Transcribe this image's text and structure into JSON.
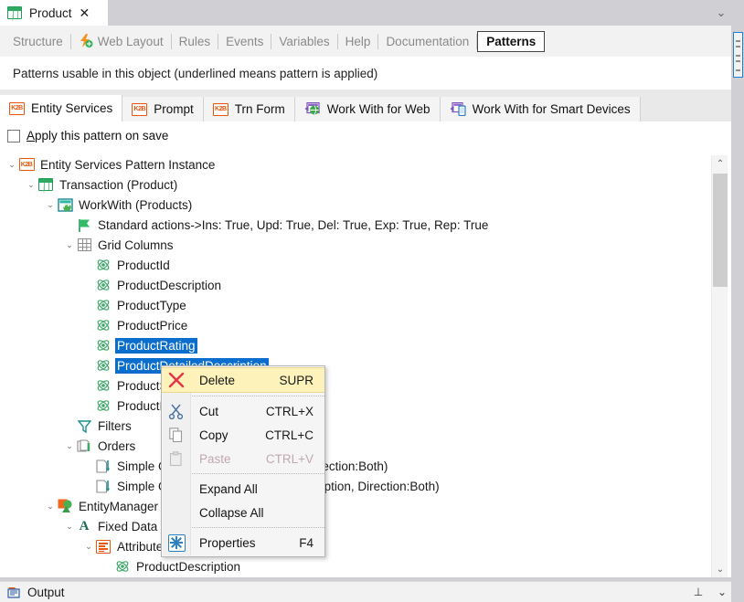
{
  "window": {
    "doc_tab": {
      "label": "Product",
      "close": "✕",
      "icon": "transaction-icon"
    },
    "tabstrip_chevron": "⌄"
  },
  "object_tabs": [
    {
      "label": "Structure",
      "icon": null,
      "active": false
    },
    {
      "label": "Web Layout",
      "icon": "web-layout-icon",
      "active": false
    },
    {
      "label": "Rules",
      "icon": null,
      "active": false
    },
    {
      "label": "Events",
      "icon": null,
      "active": false
    },
    {
      "label": "Variables",
      "icon": null,
      "active": false
    },
    {
      "label": "Help",
      "icon": null,
      "active": false
    },
    {
      "label": "Documentation",
      "icon": null,
      "active": false
    },
    {
      "label": "Patterns",
      "icon": null,
      "active": true
    }
  ],
  "patterns_header": "Patterns usable in this object (underlined means pattern is applied)",
  "pattern_tabs": [
    {
      "label": "Entity Services",
      "icon": "k2b-icon",
      "active": true
    },
    {
      "label": "Prompt",
      "icon": "k2b-icon",
      "active": false
    },
    {
      "label": "Trn Form",
      "icon": "k2b-icon",
      "active": false
    },
    {
      "label": "Work With for Web",
      "icon": "work-with-web-icon",
      "active": false
    },
    {
      "label": "Work With for Smart Devices",
      "icon": "work-with-smart-devices-icon",
      "active": false
    }
  ],
  "apply_checkbox": {
    "label_prefix": "A",
    "label_rest": "pply this pattern on save",
    "checked": false
  },
  "tree": [
    {
      "indent": 0,
      "twisty": "expanded",
      "icon": "k2b-icon",
      "label": "Entity Services Pattern Instance",
      "selected": false
    },
    {
      "indent": 1,
      "twisty": "expanded",
      "icon": "transaction-icon",
      "label": "Transaction (Product)",
      "selected": false
    },
    {
      "indent": 2,
      "twisty": "expanded",
      "icon": "workwith-icon",
      "label": "WorkWith (Products)",
      "selected": false
    },
    {
      "indent": 3,
      "twisty": "none",
      "icon": "flag-icon",
      "label": "Standard actions->Ins: True, Upd: True, Del: True, Exp: True, Rep: True",
      "selected": false
    },
    {
      "indent": 3,
      "twisty": "expanded",
      "icon": "grid-icon",
      "label": "Grid Columns",
      "selected": false
    },
    {
      "indent": 4,
      "twisty": "none",
      "icon": "attribute-icon",
      "label": "ProductId",
      "selected": false
    },
    {
      "indent": 4,
      "twisty": "none",
      "icon": "attribute-icon",
      "label": "ProductDescription",
      "selected": false
    },
    {
      "indent": 4,
      "twisty": "none",
      "icon": "attribute-icon",
      "label": "ProductType",
      "selected": false
    },
    {
      "indent": 4,
      "twisty": "none",
      "icon": "attribute-icon",
      "label": "ProductPrice",
      "selected": false
    },
    {
      "indent": 4,
      "twisty": "none",
      "icon": "attribute-icon",
      "label": "ProductRating",
      "selected": true
    },
    {
      "indent": 4,
      "twisty": "none",
      "icon": "attribute-icon",
      "label": "ProductDetailedDescription",
      "selected": true
    },
    {
      "indent": 4,
      "twisty": "none",
      "icon": "attribute-icon",
      "label": "ProductStock",
      "selected": false
    },
    {
      "indent": 4,
      "twisty": "none",
      "icon": "attribute-icon",
      "label": "ProductImage",
      "selected": false
    },
    {
      "indent": 3,
      "twisty": "none",
      "icon": "filter-icon",
      "label": "Filters",
      "selected": false
    },
    {
      "indent": 3,
      "twisty": "expanded",
      "icon": "orders-icon",
      "label": "Orders",
      "selected": false
    },
    {
      "indent": 4,
      "twisty": "none",
      "icon": "simple-order-icon",
      "label": "Simple Order (Attribute:ProductId, Direction:Both)",
      "selected": false
    },
    {
      "indent": 4,
      "twisty": "none",
      "icon": "simple-order-icon",
      "label": "Simple Order (Attribute:ProductDescription, Direction:Both)",
      "selected": false
    },
    {
      "indent": 2,
      "twisty": "expanded",
      "icon": "entity-manager-icon",
      "label": "EntityManager (Product)",
      "selected": false
    },
    {
      "indent": 3,
      "twisty": "expanded",
      "icon": "fixed-data-icon",
      "label": "Fixed Data",
      "selected": false
    },
    {
      "indent": 4,
      "twisty": "expanded",
      "icon": "attributes-icon",
      "label": "Attributes",
      "selected": false
    },
    {
      "indent": 5,
      "twisty": "none",
      "icon": "attribute-icon",
      "label": "ProductDescription",
      "selected": false
    }
  ],
  "context_menu": [
    {
      "label": "Delete",
      "accel": "SUPR",
      "icon": "delete-icon",
      "state": "highlighted"
    },
    {
      "sep": true
    },
    {
      "label": "Cut",
      "accel": "CTRL+X",
      "icon": "cut-icon",
      "state": "normal"
    },
    {
      "label": "Copy",
      "accel": "CTRL+C",
      "icon": "copy-icon",
      "state": "normal"
    },
    {
      "label": "Paste",
      "accel": "CTRL+V",
      "icon": "paste-icon",
      "state": "disabled"
    },
    {
      "sep": true
    },
    {
      "label": "Expand All",
      "accel": "",
      "icon": null,
      "state": "normal"
    },
    {
      "label": "Collapse All",
      "accel": "",
      "icon": null,
      "state": "normal"
    },
    {
      "sep": true
    },
    {
      "label": "Properties",
      "accel": "F4",
      "icon": "properties-icon",
      "state": "normal"
    }
  ],
  "scrollbar": {
    "up": "⌃",
    "down": "⌄"
  },
  "output_bar": {
    "label": "Output",
    "pin": "⊥",
    "chevron": "⌄"
  },
  "colors": {
    "selection_blue": "#0b6ecd",
    "menu_highlight": "#fdf2ba",
    "k2b_orange": "#e8560f",
    "transaction_green": "#1f9d55",
    "chrome_gray": "#cfcfd4"
  }
}
